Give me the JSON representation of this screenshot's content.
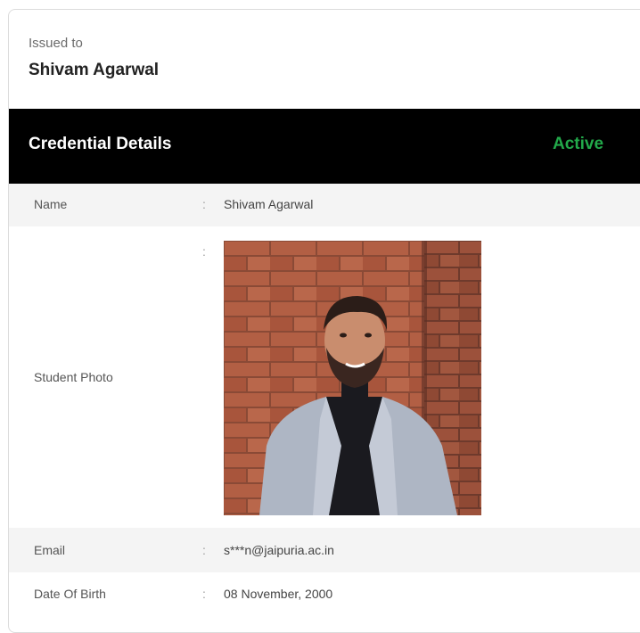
{
  "issued": {
    "label": "Issued to",
    "name": "Shivam Agarwal"
  },
  "credential": {
    "title": "Credential Details",
    "status": "Active",
    "status_color": "#22a94a"
  },
  "fields": {
    "name": {
      "label": "Name",
      "value": "Shivam Agarwal"
    },
    "photo": {
      "label": "Student Photo"
    },
    "email": {
      "label": "Email",
      "value": "s***n@jaipuria.ac.in"
    },
    "dob": {
      "label": "Date Of Birth",
      "value": "08 November, 2000"
    }
  },
  "separator": ":"
}
